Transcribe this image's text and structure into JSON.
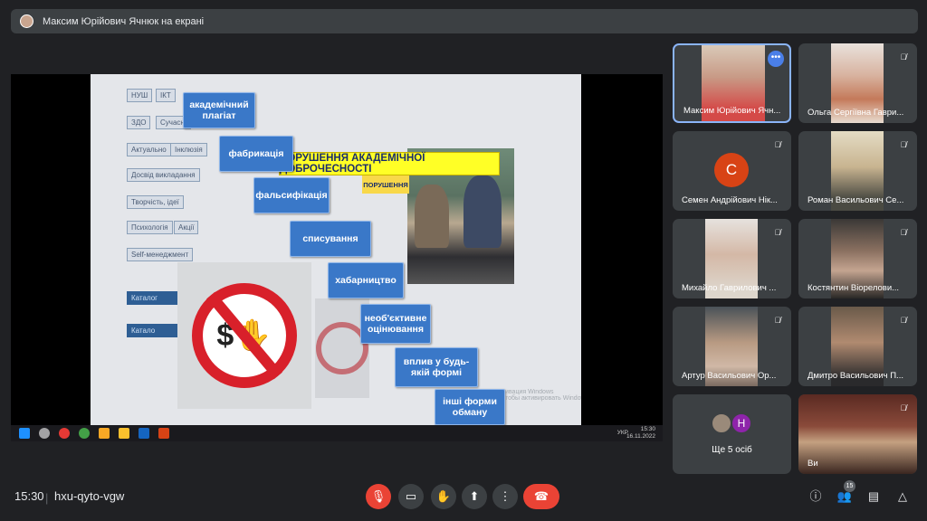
{
  "banner": {
    "presenter_text": "Максим Юрійович Ячнюк на екрані"
  },
  "slide": {
    "callout": "ПОРУШЕННЯ АКАДЕМІЧНОЇ ДОБРОЧЕСНОСТІ",
    "callout_small": "ПОРУШЕННЯ",
    "steps": [
      "академічний плагіат",
      "фабрикація",
      "фальсифікація",
      "списування",
      "хабарництво",
      "необ'єктивне оцінювання",
      "вплив у будь-якій формі",
      "інші форми обману"
    ],
    "side_boxes": [
      "НУШ",
      "ІКТ",
      "ЗДО",
      "Сучасні",
      "Актуально",
      "Інклюзія",
      "Досвід викладання",
      "Творчість, ідеї",
      "Психологія",
      "Акції",
      "Self-менеджмент",
      "Каталог",
      "Катало"
    ],
    "watermark": "ивация Windows\nтобы активировать Windows, перейдите в раздел \"Параметры\"."
  },
  "taskbar": {
    "time": "15:30",
    "date": "16.11.2022",
    "lang": "УКР"
  },
  "participants": [
    {
      "name": "Максим Юрійович Ячн...",
      "type": "video",
      "active": true
    },
    {
      "name": "Ольга Сергіївна Гаври...",
      "type": "video",
      "muted": true
    },
    {
      "name": "Семен Андрійович Нік...",
      "type": "avatar",
      "letter": "С",
      "muted": true
    },
    {
      "name": "Роман Васильович Се...",
      "type": "video",
      "muted": true
    },
    {
      "name": "Михайло Гаврилович ...",
      "type": "video",
      "muted": true
    },
    {
      "name": "Костянтин Віорелови...",
      "type": "video",
      "muted": true
    },
    {
      "name": "Артур Васильович Ор...",
      "type": "video",
      "muted": true
    },
    {
      "name": "Дмитро Васильович П...",
      "type": "video",
      "muted": true
    },
    {
      "name": "Ще 5 осіб",
      "type": "more",
      "letter": "Н"
    },
    {
      "name": "Ви",
      "type": "video",
      "muted": true
    }
  ],
  "bottom": {
    "time": "15:30",
    "separator": "|",
    "meeting_code": "hxu-qyto-vgw",
    "people_count": "15"
  },
  "colors": {
    "end_call": "#ea4335",
    "bg": "#202124",
    "tile": "#3c4043",
    "accent": "#4a7fe8"
  }
}
